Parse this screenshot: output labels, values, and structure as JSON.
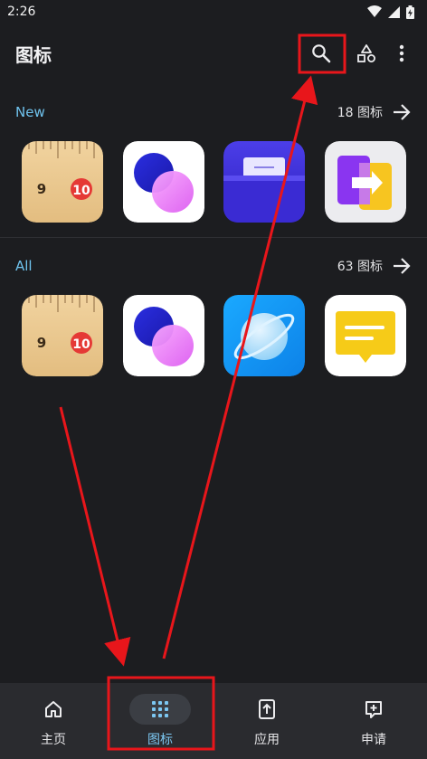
{
  "status": {
    "time": "2:26"
  },
  "app_bar": {
    "title": "图标"
  },
  "sections": [
    {
      "title": "New",
      "count": "18 图标"
    },
    {
      "title": "All",
      "count": "63 图标"
    }
  ],
  "nav": [
    {
      "label": "主页",
      "icon": "home-icon",
      "active": false
    },
    {
      "label": "图标",
      "icon": "grid-icon",
      "active": true
    },
    {
      "label": "应用",
      "icon": "upload-icon",
      "active": false
    },
    {
      "label": "申请",
      "icon": "add-comment-icon",
      "active": false
    }
  ],
  "colors": {
    "background": "#1c1d20",
    "accent": "#6fc3ee",
    "annotation": "#e8161b"
  },
  "icons": {
    "new": [
      "ruler-icon",
      "overlap-circles-icon",
      "wallet-card-icon",
      "transfer-icon"
    ],
    "all": [
      "ruler-icon",
      "overlap-circles-icon",
      "planet-icon",
      "message-note-icon"
    ]
  },
  "ruler_labels": {
    "left": "9",
    "right": "10"
  }
}
